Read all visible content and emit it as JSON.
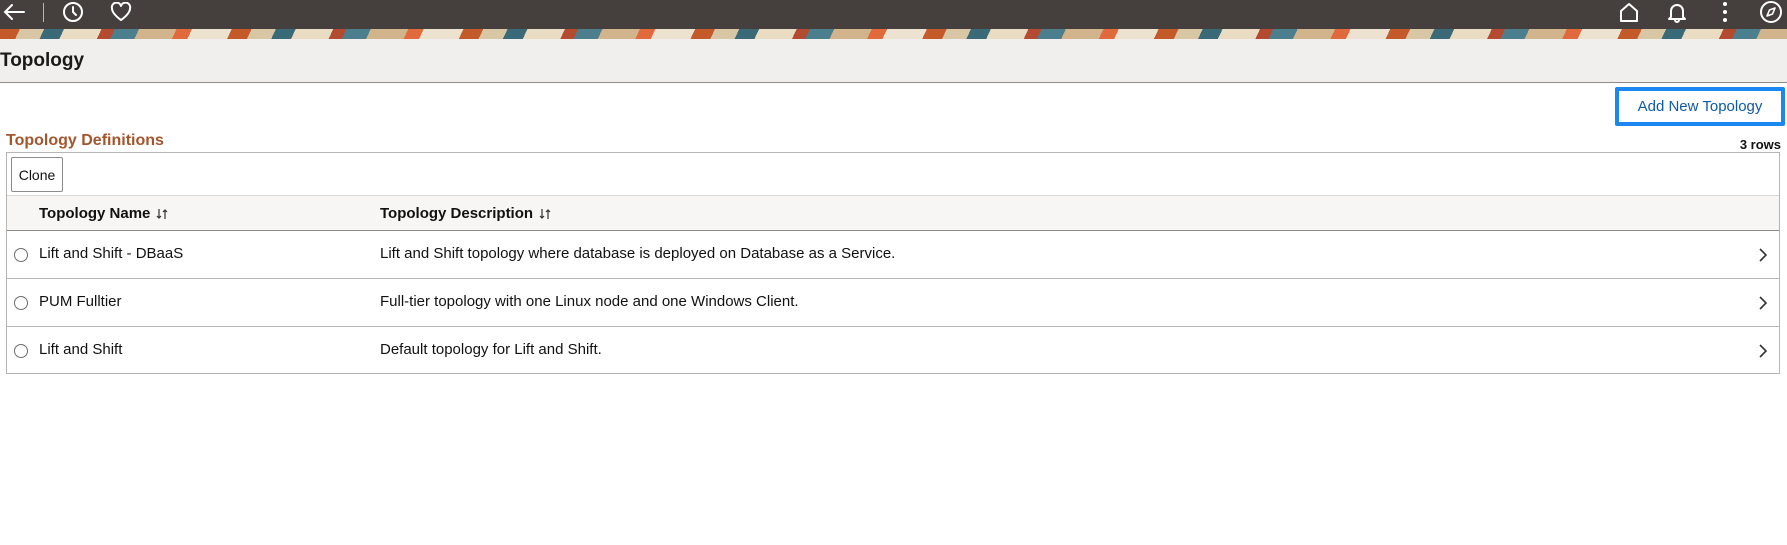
{
  "topbar": {
    "icons": [
      "back-arrow-icon",
      "history-icon",
      "favorites-heart-icon",
      "home-icon",
      "notification-bell-icon",
      "more-actions-icon",
      "navigator-compass-icon"
    ]
  },
  "page": {
    "title": "Topology"
  },
  "actions": {
    "add_new_label": "Add New Topology"
  },
  "grid": {
    "title": "Topology Definitions",
    "row_count": "3 rows",
    "clone_label": "Clone",
    "columns": [
      "Topology Name",
      "Topology Description"
    ],
    "rows": [
      {
        "name": "Lift and Shift - DBaaS",
        "description": "Lift and Shift topology where database is deployed on Database as a Service."
      },
      {
        "name": "PUM Fulltier",
        "description": "Full-tier topology with one Linux node and one Windows Client."
      },
      {
        "name": "Lift and Shift",
        "description": "Default topology for Lift and Shift."
      }
    ]
  },
  "colors": {
    "topbar": "#45403d",
    "section_title": "#a4552c",
    "button_focus": "#1b87f0",
    "link": "#0f5aa6"
  }
}
